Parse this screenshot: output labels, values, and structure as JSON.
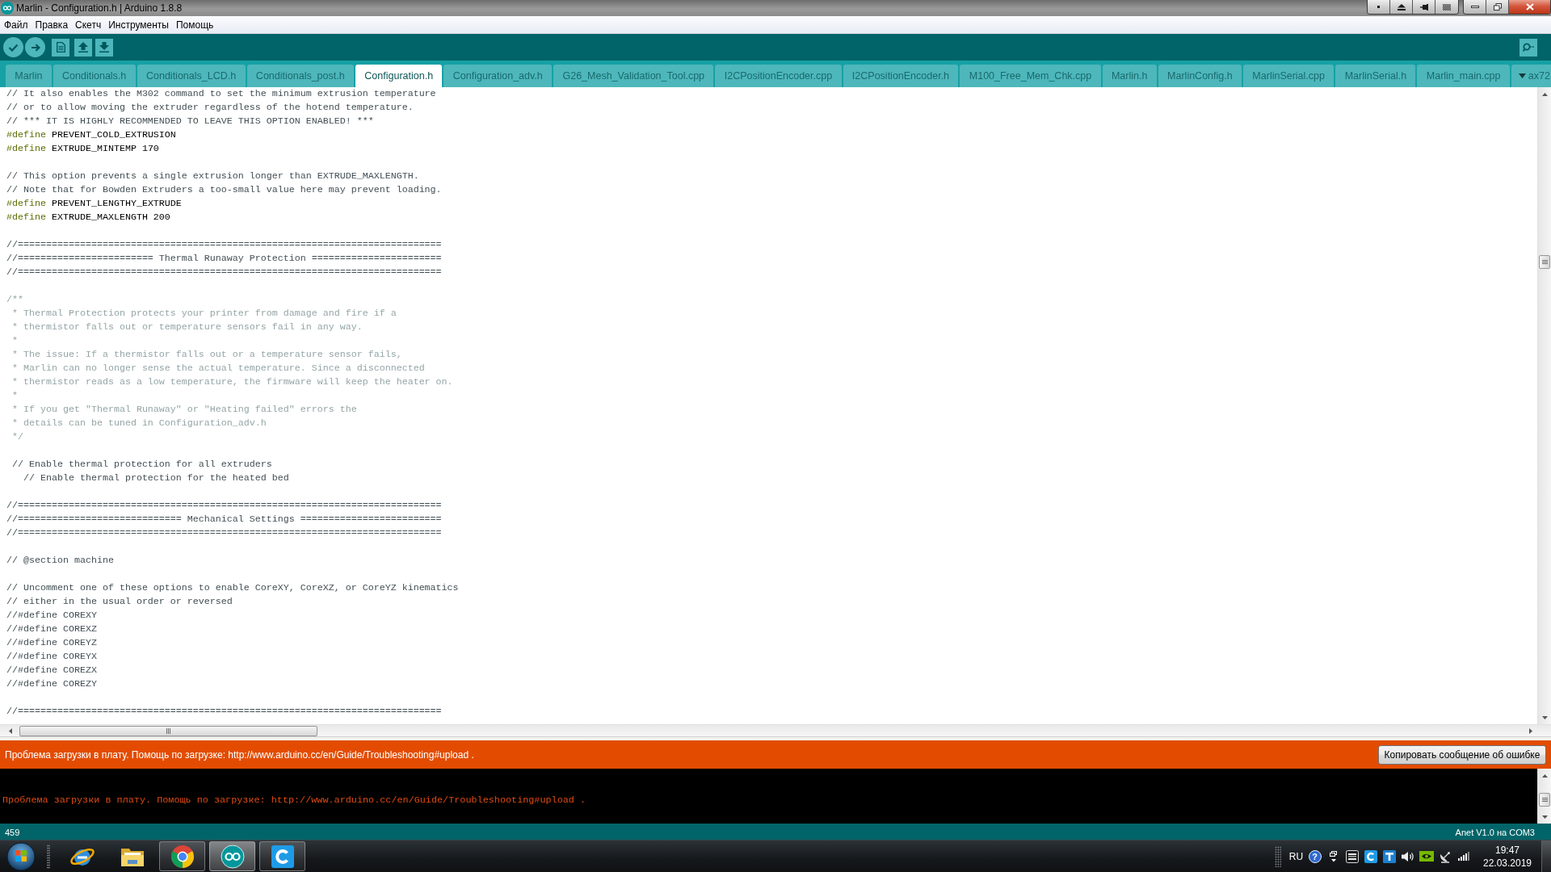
{
  "window": {
    "title": "Marlin - Configuration.h | Arduino 1.8.8"
  },
  "menu": [
    "Файл",
    "Правка",
    "Скетч",
    "Инструменты",
    "Помощь"
  ],
  "tabs": [
    {
      "label": "Marlin",
      "selected": false
    },
    {
      "label": "Conditionals.h",
      "selected": false
    },
    {
      "label": "Conditionals_LCD.h",
      "selected": false
    },
    {
      "label": "Conditionals_post.h",
      "selected": false
    },
    {
      "label": "Configuration.h",
      "selected": true
    },
    {
      "label": "Configuration_adv.h",
      "selected": false
    },
    {
      "label": "G26_Mesh_Validation_Tool.cpp",
      "selected": false
    },
    {
      "label": "I2CPositionEncoder.cpp",
      "selected": false
    },
    {
      "label": "I2CPositionEncoder.h",
      "selected": false
    },
    {
      "label": "M100_Free_Mem_Chk.cpp",
      "selected": false
    },
    {
      "label": "Marlin.h",
      "selected": false
    },
    {
      "label": "MarlinConfig.h",
      "selected": false
    },
    {
      "label": "MarlinSerial.cpp",
      "selected": false
    },
    {
      "label": "MarlinSerial.h",
      "selected": false
    },
    {
      "label": "Marlin_main.cpp",
      "selected": false
    },
    {
      "label": "ax72",
      "selected": false
    }
  ],
  "editor": {
    "lines": [
      {
        "kind": "comment",
        "text": "// It also enables the M302 command to set the minimum extrusion temperature"
      },
      {
        "kind": "comment",
        "text": "// or to allow moving the extruder regardless of the hotend temperature."
      },
      {
        "kind": "comment",
        "text": "// *** IT IS HIGHLY RECOMMENDED TO LEAVE THIS OPTION ENABLED! ***"
      },
      {
        "kind": "define",
        "directive": "#define",
        "value": "PREVENT_COLD_EXTRUSION"
      },
      {
        "kind": "define",
        "directive": "#define",
        "value": "EXTRUDE_MINTEMP 170"
      },
      {
        "kind": "blank"
      },
      {
        "kind": "comment",
        "text": "// This option prevents a single extrusion longer than EXTRUDE_MAXLENGTH."
      },
      {
        "kind": "comment",
        "text": "// Note that for Bowden Extruders a too-small value here may prevent loading."
      },
      {
        "kind": "define",
        "directive": "#define",
        "value": "PREVENT_LENGTHY_EXTRUDE"
      },
      {
        "kind": "define",
        "directive": "#define",
        "value": "EXTRUDE_MAXLENGTH 200"
      },
      {
        "kind": "blank"
      },
      {
        "kind": "comment",
        "text": "//==========================================================================="
      },
      {
        "kind": "comment",
        "text": "//======================== Thermal Runaway Protection ======================="
      },
      {
        "kind": "comment",
        "text": "//==========================================================================="
      },
      {
        "kind": "blank"
      },
      {
        "kind": "doc",
        "text": "/**"
      },
      {
        "kind": "doc",
        "text": " * Thermal Protection protects your printer from damage and fire if a"
      },
      {
        "kind": "doc",
        "text": " * thermistor falls out or temperature sensors fail in any way."
      },
      {
        "kind": "doc",
        "text": " *"
      },
      {
        "kind": "doc",
        "text": " * The issue: If a thermistor falls out or a temperature sensor fails,"
      },
      {
        "kind": "doc",
        "text": " * Marlin can no longer sense the actual temperature. Since a disconnected"
      },
      {
        "kind": "doc",
        "text": " * thermistor reads as a low temperature, the firmware will keep the heater on."
      },
      {
        "kind": "doc",
        "text": " *"
      },
      {
        "kind": "doc",
        "text": " * If you get \"Thermal Runaway\" or \"Heating failed\" errors the"
      },
      {
        "kind": "doc",
        "text": " * details can be tuned in Configuration_adv.h"
      },
      {
        "kind": "doc",
        "text": " */"
      },
      {
        "kind": "blank"
      },
      {
        "kind": "comment",
        "text": " // Enable thermal protection for all extruders"
      },
      {
        "kind": "comment",
        "text": "   // Enable thermal protection for the heated bed"
      },
      {
        "kind": "blank"
      },
      {
        "kind": "comment",
        "text": "//==========================================================================="
      },
      {
        "kind": "comment",
        "text": "//============================= Mechanical Settings ========================="
      },
      {
        "kind": "comment",
        "text": "//==========================================================================="
      },
      {
        "kind": "blank"
      },
      {
        "kind": "comment",
        "text": "// @section machine"
      },
      {
        "kind": "blank"
      },
      {
        "kind": "comment",
        "text": "// Uncomment one of these options to enable CoreXY, CoreXZ, or CoreYZ kinematics"
      },
      {
        "kind": "comment",
        "text": "// either in the usual order or reversed"
      },
      {
        "kind": "comment",
        "text": "//#define COREXY"
      },
      {
        "kind": "comment",
        "text": "//#define COREXZ"
      },
      {
        "kind": "comment",
        "text": "//#define COREYZ"
      },
      {
        "kind": "comment",
        "text": "//#define COREYX"
      },
      {
        "kind": "comment",
        "text": "//#define COREZX"
      },
      {
        "kind": "comment",
        "text": "//#define COREZY"
      },
      {
        "kind": "blank"
      },
      {
        "kind": "comment",
        "text": "//==========================================================================="
      }
    ]
  },
  "error_bar": {
    "message": "Проблема загрузки в плату. Помощь по загрузке: http://www.arduino.cc/en/Guide/Troubleshooting#upload .",
    "copy_button": "Копировать сообщение об ошибке"
  },
  "console": {
    "lines": [
      "Проблема загрузки в плату. Помощь по загрузке: http://www.arduino.cc/en/Guide/Troubleshooting#upload ."
    ]
  },
  "status_bar": {
    "line": "459",
    "board": "Anet V1.0 на COM3"
  },
  "taskbar": {
    "apps": [
      {
        "running": false,
        "selected": false
      },
      {
        "running": false,
        "selected": false
      },
      {
        "running": true,
        "selected": false
      },
      {
        "running": true,
        "selected": true
      },
      {
        "running": true,
        "selected": false
      }
    ],
    "tray": {
      "language": "RU",
      "help": "?",
      "time": "19:47",
      "date": "22.03.2019"
    }
  }
}
